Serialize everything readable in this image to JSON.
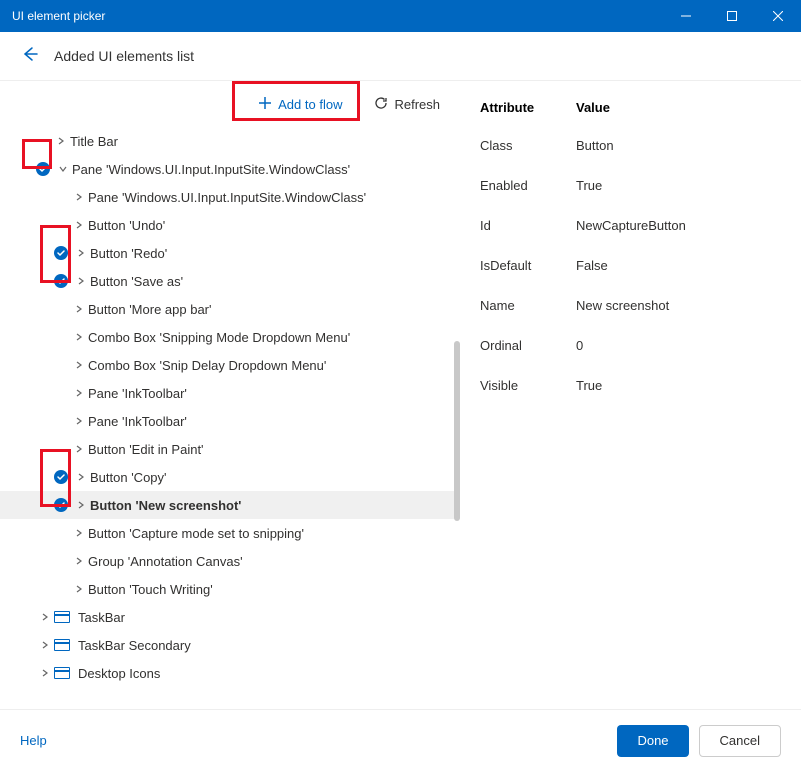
{
  "titlebar": {
    "title": "UI element picker"
  },
  "header": {
    "title": "Added UI elements list"
  },
  "toolbar": {
    "add_label": "Add to flow",
    "refresh_label": "Refresh"
  },
  "tree": {
    "items": [
      {
        "label": "Title Bar",
        "indent": 56,
        "chev": "right",
        "badge": false,
        "icon": false,
        "bold": false,
        "selected": false
      },
      {
        "label": "Pane 'Windows.UI.Input.InputSite.WindowClass'",
        "indent": 36,
        "chev": "down",
        "badge": true,
        "icon": false,
        "bold": false,
        "selected": false
      },
      {
        "label": "Pane 'Windows.UI.Input.InputSite.WindowClass'",
        "indent": 74,
        "chev": "right",
        "badge": false,
        "icon": false,
        "bold": false,
        "selected": false
      },
      {
        "label": "Button 'Undo'",
        "indent": 74,
        "chev": "right",
        "badge": false,
        "icon": false,
        "bold": false,
        "selected": false
      },
      {
        "label": "Button 'Redo'",
        "indent": 54,
        "chev": "right",
        "badge": true,
        "icon": false,
        "bold": false,
        "selected": false
      },
      {
        "label": "Button 'Save as'",
        "indent": 54,
        "chev": "right",
        "badge": true,
        "icon": false,
        "bold": false,
        "selected": false
      },
      {
        "label": "Button 'More app bar'",
        "indent": 74,
        "chev": "right",
        "badge": false,
        "icon": false,
        "bold": false,
        "selected": false
      },
      {
        "label": "Combo Box 'Snipping Mode Dropdown Menu'",
        "indent": 74,
        "chev": "right",
        "badge": false,
        "icon": false,
        "bold": false,
        "selected": false
      },
      {
        "label": "Combo Box 'Snip Delay Dropdown Menu'",
        "indent": 74,
        "chev": "right",
        "badge": false,
        "icon": false,
        "bold": false,
        "selected": false
      },
      {
        "label": "Pane 'InkToolbar'",
        "indent": 74,
        "chev": "right",
        "badge": false,
        "icon": false,
        "bold": false,
        "selected": false
      },
      {
        "label": "Pane 'InkToolbar'",
        "indent": 74,
        "chev": "right",
        "badge": false,
        "icon": false,
        "bold": false,
        "selected": false
      },
      {
        "label": "Button 'Edit in Paint'",
        "indent": 74,
        "chev": "right",
        "badge": false,
        "icon": false,
        "bold": false,
        "selected": false
      },
      {
        "label": "Button 'Copy'",
        "indent": 54,
        "chev": "right",
        "badge": true,
        "icon": false,
        "bold": false,
        "selected": false
      },
      {
        "label": "Button 'New screenshot'",
        "indent": 54,
        "chev": "right",
        "badge": true,
        "icon": false,
        "bold": true,
        "selected": true
      },
      {
        "label": "Button 'Capture mode set to snipping'",
        "indent": 74,
        "chev": "right",
        "badge": false,
        "icon": false,
        "bold": false,
        "selected": false
      },
      {
        "label": "Group 'Annotation Canvas'",
        "indent": 74,
        "chev": "right",
        "badge": false,
        "icon": false,
        "bold": false,
        "selected": false
      },
      {
        "label": "Button 'Touch Writing'",
        "indent": 74,
        "chev": "right",
        "badge": false,
        "icon": false,
        "bold": false,
        "selected": false
      },
      {
        "label": "TaskBar",
        "indent": 40,
        "chev": "right",
        "badge": false,
        "icon": true,
        "bold": false,
        "selected": false
      },
      {
        "label": "TaskBar Secondary",
        "indent": 40,
        "chev": "right",
        "badge": false,
        "icon": true,
        "bold": false,
        "selected": false
      },
      {
        "label": "Desktop Icons",
        "indent": 40,
        "chev": "right",
        "badge": false,
        "icon": true,
        "bold": false,
        "selected": false
      }
    ]
  },
  "attributes": {
    "header_key": "Attribute",
    "header_val": "Value",
    "rows": [
      {
        "key": "Class",
        "val": "Button"
      },
      {
        "key": "Enabled",
        "val": "True"
      },
      {
        "key": "Id",
        "val": "NewCaptureButton"
      },
      {
        "key": "IsDefault",
        "val": "False"
      },
      {
        "key": "Name",
        "val": "New screenshot"
      },
      {
        "key": "Ordinal",
        "val": "0"
      },
      {
        "key": "Visible",
        "val": "True"
      }
    ]
  },
  "footer": {
    "help_label": "Help",
    "done_label": "Done",
    "cancel_label": "Cancel"
  }
}
